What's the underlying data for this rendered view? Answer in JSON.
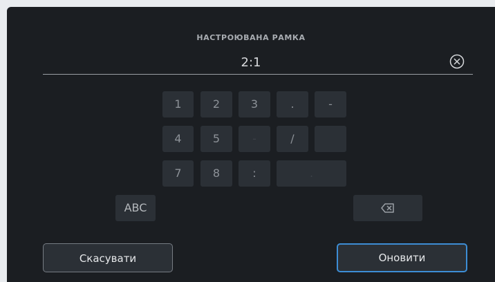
{
  "dialog": {
    "title": "НАСТРОЮВАНА РАМКА",
    "value": "2:1"
  },
  "keypad": {
    "row1": [
      "1",
      "2",
      "3",
      ".",
      "-"
    ],
    "row2": [
      "4",
      "5",
      "-",
      "/",
      ""
    ],
    "row3": [
      "7",
      "8",
      ":",
      "."
    ],
    "abc_label": "ABC"
  },
  "buttons": {
    "cancel_label": "Скасувати",
    "update_label": "Оновити"
  },
  "icons": {
    "clear": "clear-circle-x-icon",
    "backspace": "backspace-icon"
  },
  "colors": {
    "accent": "#3d8ed6",
    "panel": "#1b1e22",
    "key": "#2b3036"
  }
}
